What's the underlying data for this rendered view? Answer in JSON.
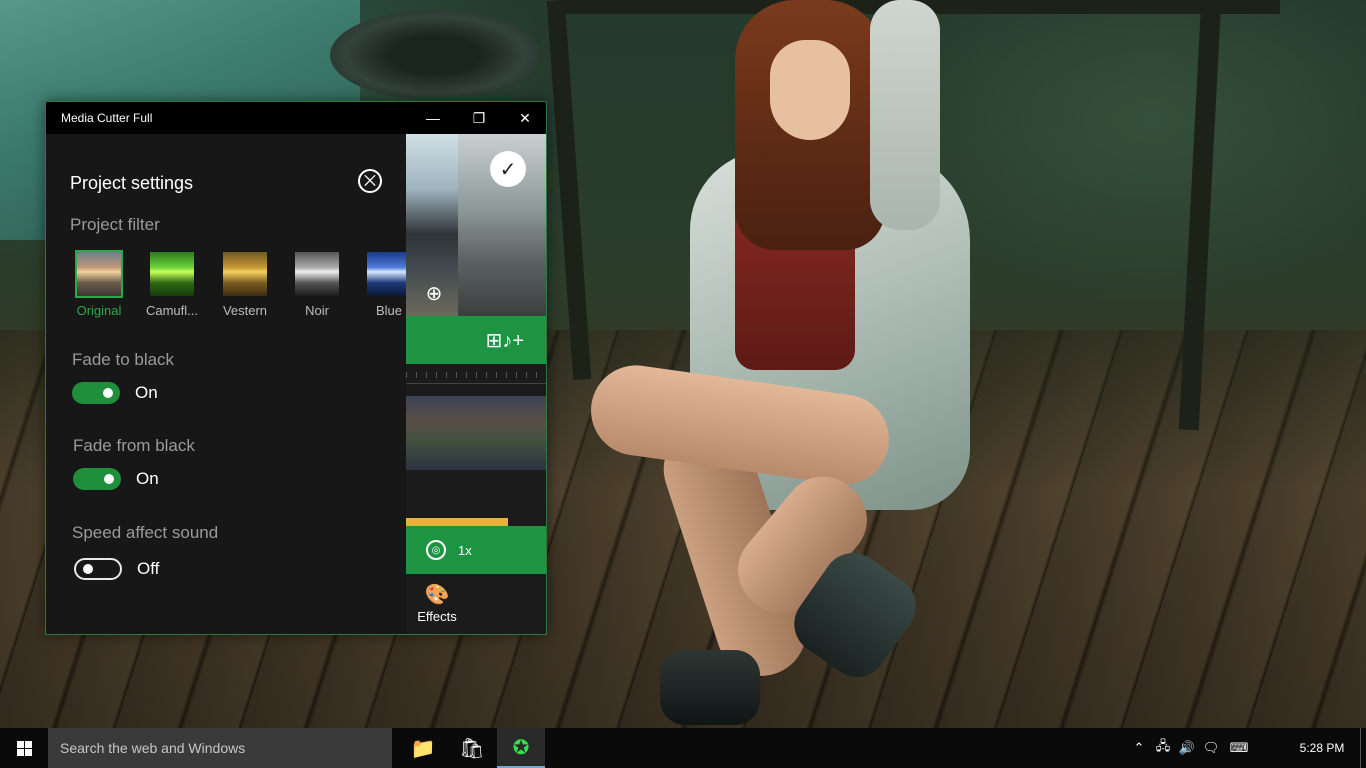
{
  "window": {
    "title": "Media Cutter Full",
    "controls": {
      "minimize": "—",
      "maximize": "❐",
      "close": "✕"
    }
  },
  "settings": {
    "title": "Project settings",
    "close_icon": "⨉",
    "project_filter_label": "Project filter",
    "filters": [
      {
        "label": "Original",
        "selected": true
      },
      {
        "label": "Camufl...",
        "selected": false
      },
      {
        "label": "Vestern",
        "selected": false
      },
      {
        "label": "Noir",
        "selected": false
      },
      {
        "label": "Blue",
        "selected": false
      }
    ],
    "fade_to_black": {
      "label": "Fade to black",
      "state": "On"
    },
    "fade_from_black": {
      "label": "Fade from black",
      "state": "On"
    },
    "speed_affect_sound": {
      "label": "Speed affect sound",
      "state": "Off"
    }
  },
  "preview": {
    "check_icon": "✓",
    "zoom_icon": "⊕",
    "add_media_icon": "⊞♪+",
    "speed_icon": "◎",
    "speed_label": "1x",
    "effects_icon": "🎨",
    "effects_label": "Effects"
  },
  "taskbar": {
    "search_placeholder": "Search the web and Windows",
    "apps": [
      {
        "name": "file-explorer-icon",
        "glyph": "📁"
      },
      {
        "name": "store-icon",
        "glyph": "🛍"
      },
      {
        "name": "media-cutter-icon",
        "glyph": "✪"
      }
    ],
    "tray": {
      "chevron": "⌃",
      "network": "🖧",
      "volume": "🔊",
      "notifications": "🗨",
      "keyboard": "⌨"
    },
    "time": "5:28 PM"
  },
  "colors": {
    "accent_green": "#1e9443",
    "selected_filter_text": "#2ea84c",
    "audio_track": "#e2b53a"
  }
}
